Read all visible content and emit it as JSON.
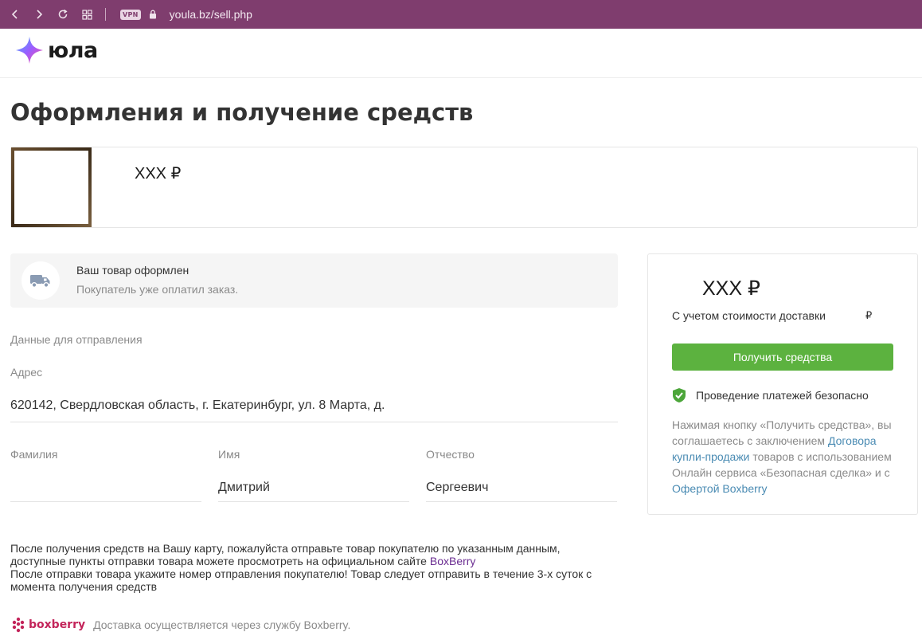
{
  "browser": {
    "vpn_badge": "VPN",
    "url": "youla.bz/sell.php"
  },
  "header": {
    "logo_text": "юла"
  },
  "page": {
    "title": "Оформления и получение средств"
  },
  "product": {
    "price": "XXX ₽"
  },
  "status": {
    "title": "Ваш товар оформлен",
    "subtitle": "Покупатель уже оплатил заказ."
  },
  "shipping": {
    "section_label": "Данные для отправления",
    "address_label": "Адрес",
    "address_value": "620142, Свердловская область, г. Екатеринбург, ул. 8 Марта, д.",
    "fields": [
      {
        "label": "Фамилия",
        "value": ""
      },
      {
        "label": "Имя",
        "value": "Дмитрий"
      },
      {
        "label": "Отчество",
        "value": "Сергеевич"
      }
    ]
  },
  "note": {
    "text_1": "После получения средств на Вашу карту, пожалуйста отправьте товар покупателю по указанным данным, доступные пункты отправки товара можете просмотреть на официальном сайте ",
    "link": "BoxBerry",
    "text_2": "После отправки товара укажите номер отправления покупателю! Товар следует отправить в течение 3-х суток с момента получения средств"
  },
  "footer": {
    "brand": "boxberry",
    "text": "Доставка осуществляется через службу Boxberry."
  },
  "payment": {
    "amount": "XXX ₽",
    "delivery_note": "С учетом стоимости доставки",
    "delivery_currency": "₽",
    "button_label": "Получить средства",
    "secure_text": "Проведение платежей безопасно",
    "terms_1": "Нажимая кнопку «Получить средства», вы соглашаетесь с заключением ",
    "terms_link_1": "Договора купли-продажи",
    "terms_2": " товаров с использованием Онлайн сервиса «Безопасная сделка» и с ",
    "terms_link_2": "Офертой Boxberry"
  },
  "colors": {
    "browser_bar": "#7f3d6e",
    "accent_green": "#5cb23f",
    "link_blue": "#4a8bb3",
    "link_purple": "#6a2c91",
    "boxberry_brand": "#c3245a"
  }
}
